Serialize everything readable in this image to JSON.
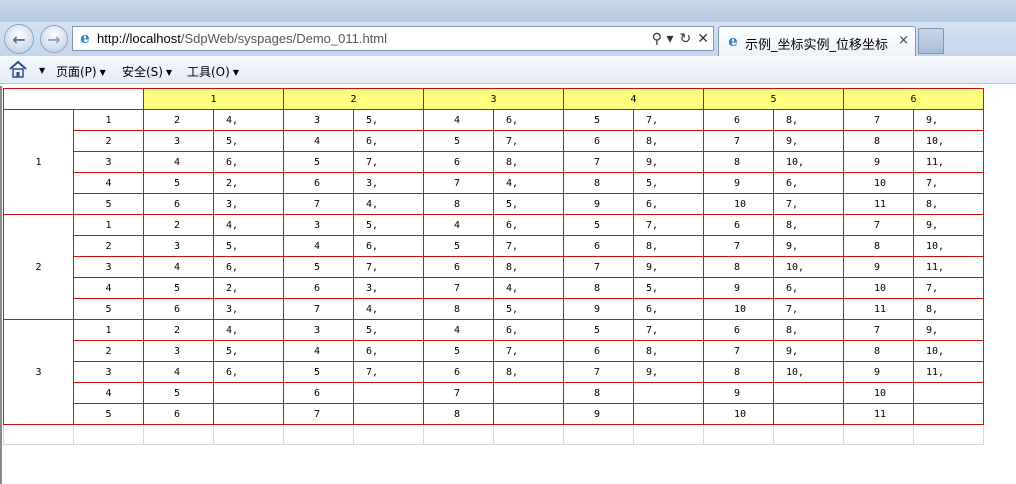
{
  "browser": {
    "back_label": "back",
    "forward_label": "forward",
    "url_host": "http://localhost",
    "url_path": "/SdpWeb/syspages/Demo_011.html",
    "tab_title": "示例_坐标实例_位移坐标",
    "tab_close": "×",
    "address_search": "⚲ ▾",
    "address_refresh": "↻",
    "address_stop": "✕"
  },
  "commandbar": {
    "page_label": "页面(P)",
    "safety_label": "安全(S)",
    "tools_label": "工具(O)"
  },
  "table": {
    "column_headers": [
      "1",
      "2",
      "3",
      "4",
      "5",
      "6"
    ],
    "groups": [
      {
        "label": "1",
        "rows": [
          {
            "idx": "1",
            "cells": [
              [
                "2",
                "4,"
              ],
              [
                "3",
                "5,"
              ],
              [
                "4",
                "6,"
              ],
              [
                "5",
                "7,"
              ],
              [
                "6",
                "8,"
              ],
              [
                "7",
                "9,"
              ]
            ]
          },
          {
            "idx": "2",
            "cells": [
              [
                "3",
                "5,"
              ],
              [
                "4",
                "6,"
              ],
              [
                "5",
                "7,"
              ],
              [
                "6",
                "8,"
              ],
              [
                "7",
                "9,"
              ],
              [
                "8",
                "10,"
              ]
            ]
          },
          {
            "idx": "3",
            "cells": [
              [
                "4",
                "6,"
              ],
              [
                "5",
                "7,"
              ],
              [
                "6",
                "8,"
              ],
              [
                "7",
                "9,"
              ],
              [
                "8",
                "10,"
              ],
              [
                "9",
                "11,"
              ]
            ]
          },
          {
            "idx": "4",
            "cells": [
              [
                "5",
                "2,"
              ],
              [
                "6",
                "3,"
              ],
              [
                "7",
                "4,"
              ],
              [
                "8",
                "5,"
              ],
              [
                "9",
                "6,"
              ],
              [
                "10",
                "7,"
              ]
            ]
          },
          {
            "idx": "5",
            "cells": [
              [
                "6",
                "3,"
              ],
              [
                "7",
                "4,"
              ],
              [
                "8",
                "5,"
              ],
              [
                "9",
                "6,"
              ],
              [
                "10",
                "7,"
              ],
              [
                "11",
                "8,"
              ]
            ]
          }
        ]
      },
      {
        "label": "2",
        "rows": [
          {
            "idx": "1",
            "cells": [
              [
                "2",
                "4,"
              ],
              [
                "3",
                "5,"
              ],
              [
                "4",
                "6,"
              ],
              [
                "5",
                "7,"
              ],
              [
                "6",
                "8,"
              ],
              [
                "7",
                "9,"
              ]
            ]
          },
          {
            "idx": "2",
            "cells": [
              [
                "3",
                "5,"
              ],
              [
                "4",
                "6,"
              ],
              [
                "5",
                "7,"
              ],
              [
                "6",
                "8,"
              ],
              [
                "7",
                "9,"
              ],
              [
                "8",
                "10,"
              ]
            ]
          },
          {
            "idx": "3",
            "cells": [
              [
                "4",
                "6,"
              ],
              [
                "5",
                "7,"
              ],
              [
                "6",
                "8,"
              ],
              [
                "7",
                "9,"
              ],
              [
                "8",
                "10,"
              ],
              [
                "9",
                "11,"
              ]
            ]
          },
          {
            "idx": "4",
            "cells": [
              [
                "5",
                "2,"
              ],
              [
                "6",
                "3,"
              ],
              [
                "7",
                "4,"
              ],
              [
                "8",
                "5,"
              ],
              [
                "9",
                "6,"
              ],
              [
                "10",
                "7,"
              ]
            ]
          },
          {
            "idx": "5",
            "cells": [
              [
                "6",
                "3,"
              ],
              [
                "7",
                "4,"
              ],
              [
                "8",
                "5,"
              ],
              [
                "9",
                "6,"
              ],
              [
                "10",
                "7,"
              ],
              [
                "11",
                "8,"
              ]
            ]
          }
        ]
      },
      {
        "label": "3",
        "rows": [
          {
            "idx": "1",
            "cells": [
              [
                "2",
                "4,"
              ],
              [
                "3",
                "5,"
              ],
              [
                "4",
                "6,"
              ],
              [
                "5",
                "7,"
              ],
              [
                "6",
                "8,"
              ],
              [
                "7",
                "9,"
              ]
            ]
          },
          {
            "idx": "2",
            "cells": [
              [
                "3",
                "5,"
              ],
              [
                "4",
                "6,"
              ],
              [
                "5",
                "7,"
              ],
              [
                "6",
                "8,"
              ],
              [
                "7",
                "9,"
              ],
              [
                "8",
                "10,"
              ]
            ]
          },
          {
            "idx": "3",
            "cells": [
              [
                "4",
                "6,"
              ],
              [
                "5",
                "7,"
              ],
              [
                "6",
                "8,"
              ],
              [
                "7",
                "9,"
              ],
              [
                "8",
                "10,"
              ],
              [
                "9",
                "11,"
              ]
            ]
          },
          {
            "idx": "4",
            "cells": [
              [
                "5",
                ""
              ],
              [
                "6",
                ""
              ],
              [
                "7",
                ""
              ],
              [
                "8",
                ""
              ],
              [
                "9",
                ""
              ],
              [
                "10",
                ""
              ]
            ]
          },
          {
            "idx": "5",
            "cells": [
              [
                "6",
                ""
              ],
              [
                "7",
                ""
              ],
              [
                "8",
                ""
              ],
              [
                "9",
                ""
              ],
              [
                "10",
                ""
              ],
              [
                "11",
                ""
              ]
            ]
          }
        ]
      }
    ]
  },
  "colors": {
    "grid_border": "#d01010",
    "header_fill": "#ffff7f"
  },
  "icons": [
    "back-arrow-icon",
    "forward-arrow-icon",
    "ie-page-icon",
    "search-icon",
    "refresh-icon",
    "stop-icon",
    "home-icon",
    "close-icon"
  ]
}
